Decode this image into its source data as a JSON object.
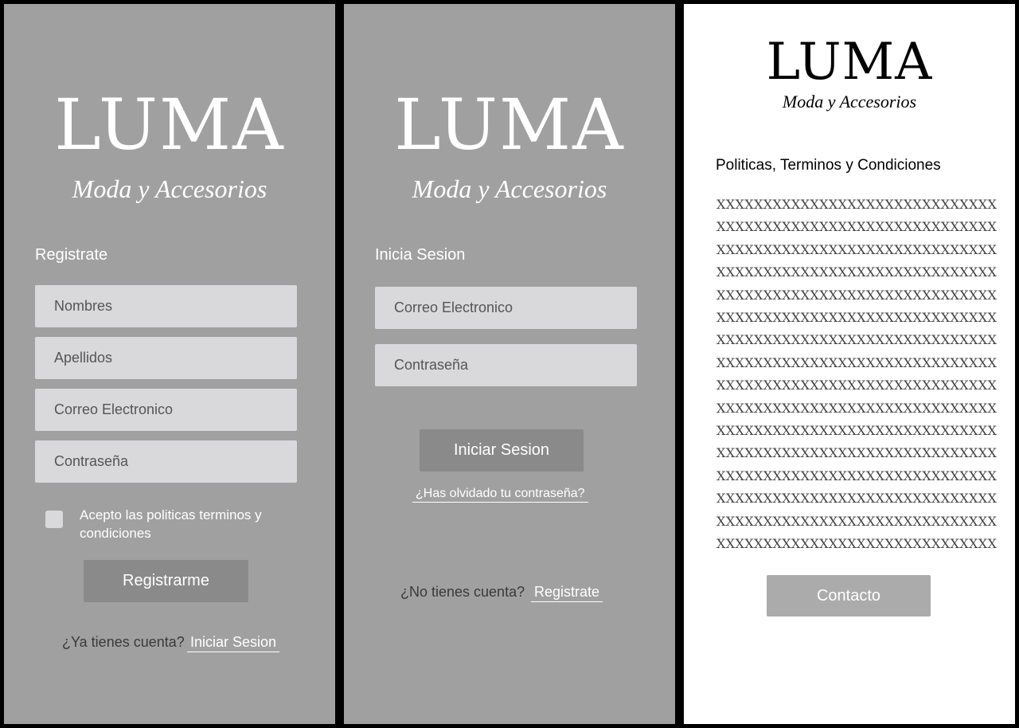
{
  "register": {
    "logo": "LUMA",
    "tagline": "Moda y Accesorios",
    "title": "Registrate",
    "fields": {
      "first_name": "Nombres",
      "last_name": "Apellidos",
      "email": "Correo Electronico",
      "password": "Contraseña"
    },
    "terms_label": "Acepto las politicas terminos y condiciones",
    "submit_label": "Registrarme",
    "have_account_text": "¿Ya tienes cuenta?",
    "login_link": "Iniciar Sesion"
  },
  "login": {
    "logo": "LUMA",
    "tagline": "Moda y Accesorios",
    "title": "Inicia Sesion",
    "fields": {
      "email": "Correo Electronico",
      "password": "Contraseña"
    },
    "submit_label": "Iniciar Sesion",
    "forgot_link": "¿Has olvidado tu contraseña?",
    "no_account_text": "¿No tienes cuenta?",
    "register_link": "Registrate"
  },
  "terms": {
    "logo": "LUMA",
    "tagline": "Moda y Accesorios",
    "title": "Politicas, Terminos y Condiciones",
    "body_lines": [
      "XXXXXXXXXXXXXXXXXXXXXXXXXXXXXX",
      "XXXXXXXXXXXXXXXXXXXXXXXXXXXXXX",
      "XXXXXXXXXXXXXXXXXXXXXXXXXXXXXX",
      "XXXXXXXXXXXXXXXXXXXXXXXXXXXXXX",
      "XXXXXXXXXXXXXXXXXXXXXXXXXXXXXX",
      "XXXXXXXXXXXXXXXXXXXXXXXXXXXXXX",
      "XXXXXXXXXXXXXXXXXXXXXXXXXXXXXX",
      "XXXXXXXXXXXXXXXXXXXXXXXXXXXXXX",
      "XXXXXXXXXXXXXXXXXXXXXXXXXXXXXX",
      "XXXXXXXXXXXXXXXXXXXXXXXXXXXXXX",
      "XXXXXXXXXXXXXXXXXXXXXXXXXXXXXX",
      "XXXXXXXXXXXXXXXXXXXXXXXXXXXXXX",
      "XXXXXXXXXXXXXXXXXXXXXXXXXXXXXX",
      "XXXXXXXXXXXXXXXXXXXXXXXXXXXXXX",
      "XXXXXXXXXXXXXXXXXXXXXXXXXXXXXX",
      "XXXXXXXXXXXXXXXXXXXXXXXXXXXXXX"
    ],
    "contact_label": "Contacto"
  },
  "colors": {
    "panel_gray": "#a0a0a0",
    "field_bg": "#d9d9dc",
    "button_dark": "#8a8a8a",
    "button_light": "#ababab"
  }
}
